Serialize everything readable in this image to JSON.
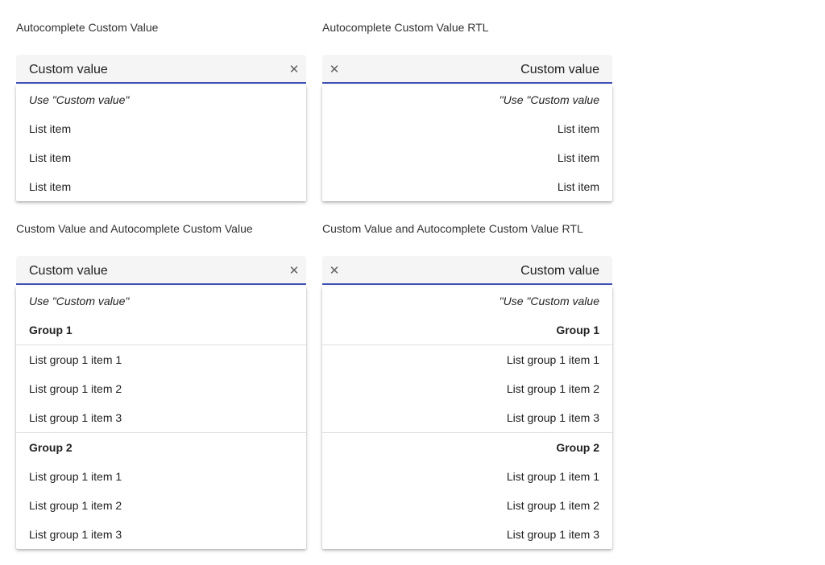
{
  "demos": [
    {
      "title": "Autocomplete Custom Value",
      "value": "Custom value",
      "clear_glyph": "✕",
      "options": [
        "Use \"Custom value\"",
        "List item",
        "List item",
        "List item"
      ]
    },
    {
      "title": "Autocomplete Custom Value RTL",
      "value": "Custom value",
      "clear_glyph": "✕",
      "options": [
        "\"Use \"Custom value",
        "List item",
        "List item",
        "List item"
      ]
    },
    {
      "title": "Custom Value and Autocomplete Custom Value",
      "value": "Custom value",
      "clear_glyph": "✕",
      "custom_option": "Use \"Custom value\"",
      "groups": [
        {
          "label": "Group 1",
          "items": [
            "List group 1 item 1",
            "List group 1 item 2",
            "List group 1 item 3"
          ]
        },
        {
          "label": "Group 2",
          "items": [
            "List group 1 item 1",
            "List group 1 item 2",
            "List group 1 item 3"
          ]
        }
      ]
    },
    {
      "title": "Custom Value and Autocomplete Custom Value RTL",
      "value": "Custom value",
      "clear_glyph": "✕",
      "custom_option": "\"Use \"Custom value",
      "groups": [
        {
          "label": "Group 1",
          "items": [
            "List group 1 item 1",
            "List group 1 item 2",
            "List group 1 item 3"
          ]
        },
        {
          "label": "Group 2",
          "items": [
            "List group 1 item 1",
            "List group 1 item 2",
            "List group 1 item 3"
          ]
        }
      ]
    }
  ],
  "colors": {
    "accent": "#3f51b5",
    "field_bg": "#f5f5f5",
    "divider": "#e0e0e0"
  },
  "icons": {
    "clear": "close-icon"
  }
}
